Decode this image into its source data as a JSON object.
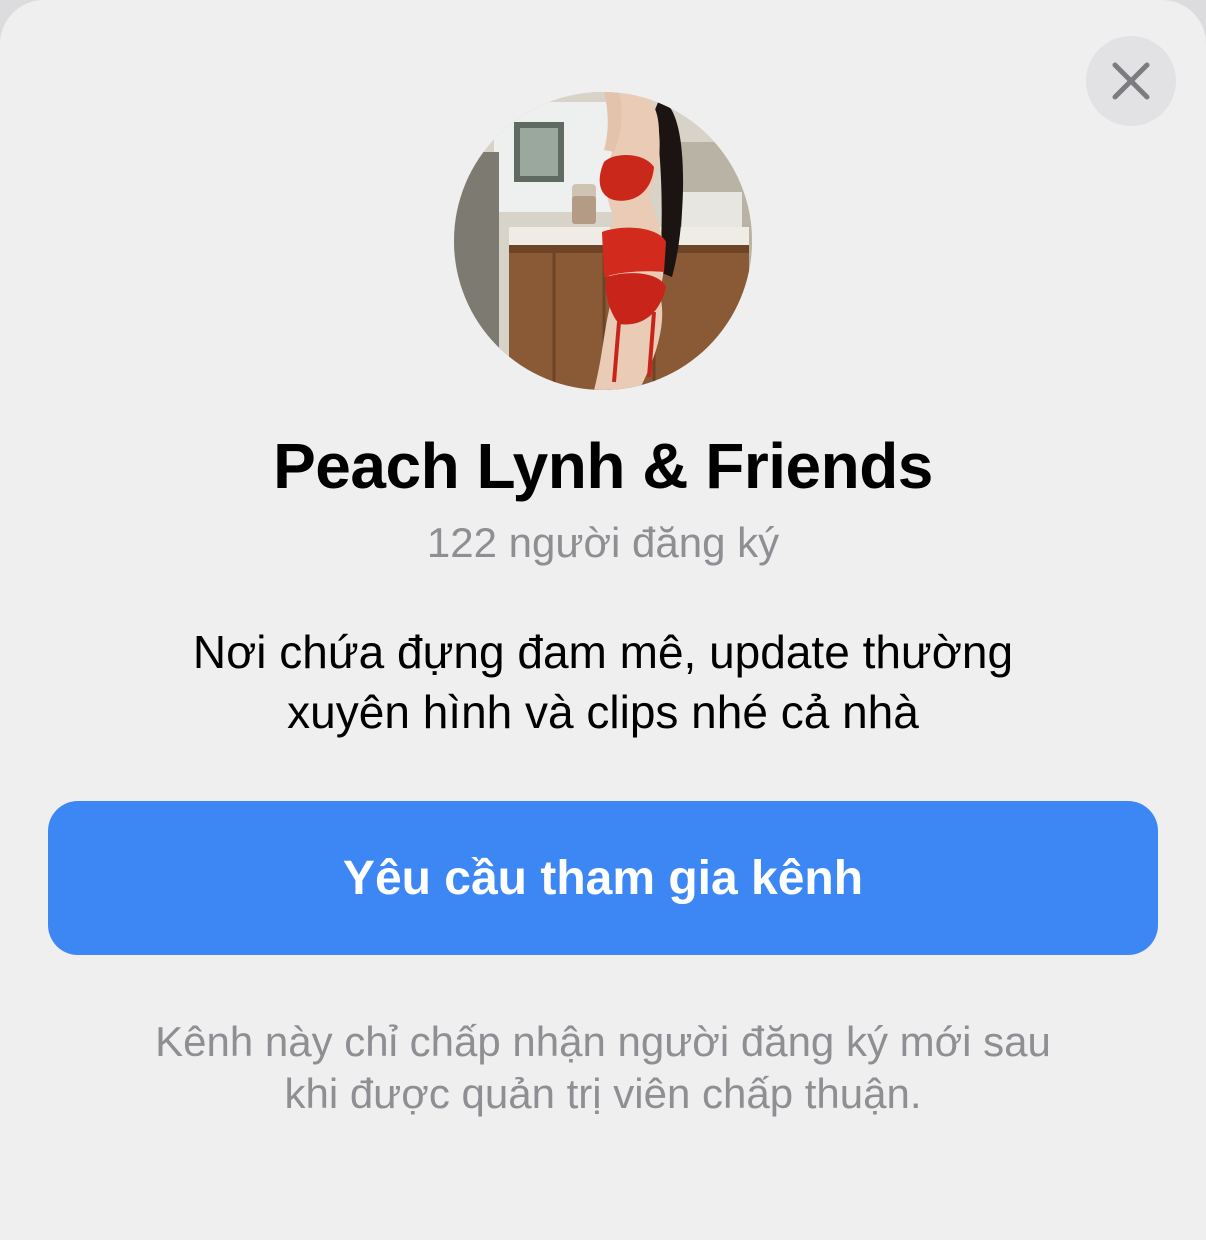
{
  "dialog": {
    "close_icon": "close-icon",
    "avatar_icon": "channel-avatar",
    "channel_name": "Peach Lynh & Friends",
    "subscribers": "122 người đăng ký",
    "description_lines": [
      "Nơi chứa đựng đam mê, update thường",
      "xuyên hình và clips nhé cả nhà"
    ],
    "join_button_label": "Yêu cầu tham gia kênh",
    "footnote_lines": [
      "Kênh này chỉ chấp nhận người đăng ký mới sau",
      "khi được quản trị viên chấp thuận."
    ]
  },
  "colors": {
    "sheet_background": "#efeff0",
    "accent_button": "#3d87f5",
    "secondary_text": "#8e8e93",
    "close_button_bg": "#e2e2e4"
  }
}
